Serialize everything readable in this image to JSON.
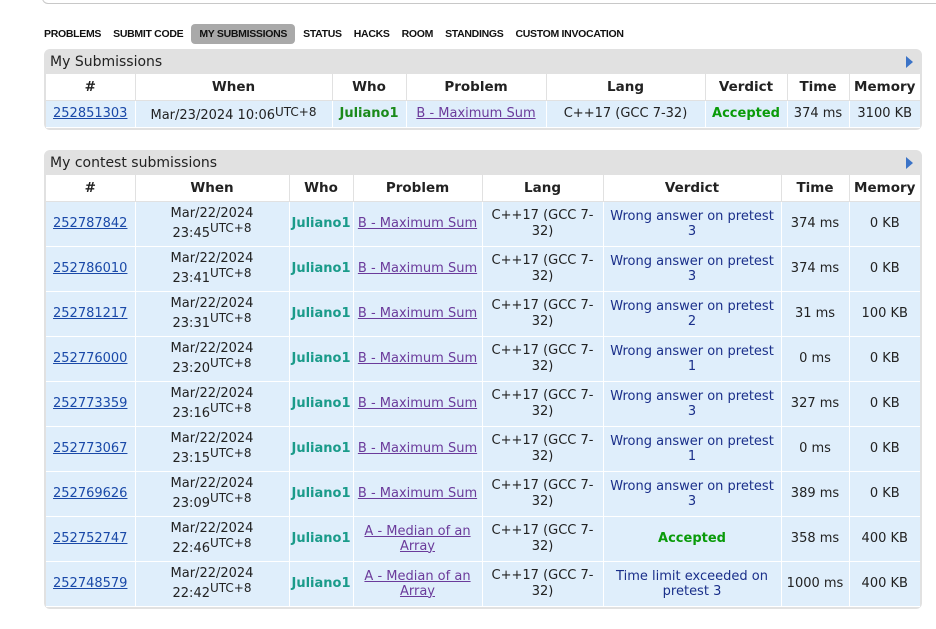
{
  "menu": {
    "items": [
      "PROBLEMS",
      "SUBMIT CODE",
      "MY SUBMISSIONS",
      "STATUS",
      "HACKS",
      "ROOM",
      "STANDINGS",
      "CUSTOM INVOCATION"
    ],
    "active": "MY SUBMISSIONS"
  },
  "my_submissions": {
    "title": "My Submissions",
    "headers": [
      "#",
      "When",
      "Who",
      "Problem",
      "Lang",
      "Verdict",
      "Time",
      "Memory"
    ],
    "rows": [
      {
        "id": "252851303",
        "date": "Mar/23/2024 10:06",
        "tz": "UTC+8",
        "who": "Juliano1",
        "problem": "B - Maximum Sum",
        "lang": "C++17 (GCC 7-32)",
        "verdict": "Accepted",
        "time": "374 ms",
        "memory": "3100 KB"
      }
    ]
  },
  "contest_submissions": {
    "title": "My contest submissions",
    "headers": [
      "#",
      "When",
      "Who",
      "Problem",
      "Lang",
      "Verdict",
      "Time",
      "Memory"
    ],
    "rows": [
      {
        "id": "252787842",
        "date": "Mar/22/2024",
        "clock": "23:45",
        "tz": "UTC+8",
        "who": "Juliano1",
        "problem": "B - Maximum Sum",
        "lang_a": "C++17 (GCC 7-",
        "lang_b": "32)",
        "verdict": "Wrong answer on pretest 3",
        "time": "374 ms",
        "memory": "0 KB"
      },
      {
        "id": "252786010",
        "date": "Mar/22/2024",
        "clock": "23:41",
        "tz": "UTC+8",
        "who": "Juliano1",
        "problem": "B - Maximum Sum",
        "lang_a": "C++17 (GCC 7-",
        "lang_b": "32)",
        "verdict": "Wrong answer on pretest 3",
        "time": "374 ms",
        "memory": "0 KB"
      },
      {
        "id": "252781217",
        "date": "Mar/22/2024",
        "clock": "23:31",
        "tz": "UTC+8",
        "who": "Juliano1",
        "problem": "B - Maximum Sum",
        "lang_a": "C++17 (GCC 7-",
        "lang_b": "32)",
        "verdict": "Wrong answer on pretest 2",
        "time": "31 ms",
        "memory": "100 KB"
      },
      {
        "id": "252776000",
        "date": "Mar/22/2024",
        "clock": "23:20",
        "tz": "UTC+8",
        "who": "Juliano1",
        "problem": "B - Maximum Sum",
        "lang_a": "C++17 (GCC 7-",
        "lang_b": "32)",
        "verdict": "Wrong answer on pretest 1",
        "time": "0 ms",
        "memory": "0 KB"
      },
      {
        "id": "252773359",
        "date": "Mar/22/2024",
        "clock": "23:16",
        "tz": "UTC+8",
        "who": "Juliano1",
        "problem": "B - Maximum Sum",
        "lang_a": "C++17 (GCC 7-",
        "lang_b": "32)",
        "verdict": "Wrong answer on pretest 3",
        "time": "327 ms",
        "memory": "0 KB"
      },
      {
        "id": "252773067",
        "date": "Mar/22/2024",
        "clock": "23:15",
        "tz": "UTC+8",
        "who": "Juliano1",
        "problem": "B - Maximum Sum",
        "lang_a": "C++17 (GCC 7-",
        "lang_b": "32)",
        "verdict": "Wrong answer on pretest 1",
        "time": "0 ms",
        "memory": "0 KB"
      },
      {
        "id": "252769626",
        "date": "Mar/22/2024",
        "clock": "23:09",
        "tz": "UTC+8",
        "who": "Juliano1",
        "problem": "B - Maximum Sum",
        "lang_a": "C++17 (GCC 7-",
        "lang_b": "32)",
        "verdict": "Wrong answer on pretest 3",
        "time": "389 ms",
        "memory": "0 KB"
      },
      {
        "id": "252752747",
        "date": "Mar/22/2024",
        "clock": "22:46",
        "tz": "UTC+8",
        "who": "Juliano1",
        "problem_a": "A - Median of an",
        "problem_b": "Array",
        "lang_a": "C++17 (GCC 7-",
        "lang_b": "32)",
        "verdict": "Accepted",
        "time": "358 ms",
        "memory": "400 KB"
      },
      {
        "id": "252748579",
        "date": "Mar/22/2024",
        "clock": "22:42",
        "tz": "UTC+8",
        "who": "Juliano1",
        "problem_a": "A - Median of an",
        "problem_b": "Array",
        "lang_a": "C++17 (GCC 7-",
        "lang_b": "32)",
        "verdict_a": "Time limit exceeded on",
        "verdict_b": "pretest 3",
        "time": "1000 ms",
        "memory": "400 KB"
      }
    ]
  },
  "colors": {
    "header_bg": "#e1e1e1",
    "row_bg": "#dfeefb",
    "accepted": "#0a9b0a",
    "wrong": "#1a2f8a",
    "link": "#1a49a8",
    "arrow": "#3b73c7"
  },
  "icons": {
    "expand": "right-triangle-icon"
  }
}
